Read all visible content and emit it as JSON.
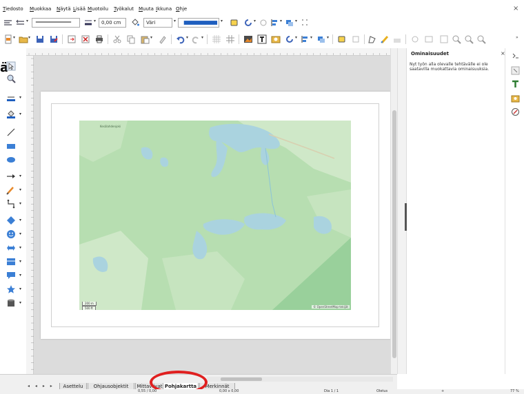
{
  "menubar": {
    "items": [
      "Tiedosto",
      "Muokkaa",
      "Näytä",
      "Lisää",
      "Muotoilu",
      "Työkalut",
      "Muuta",
      "Ikkuna",
      "Ohje"
    ]
  },
  "toolbar1": {
    "line_width_value": "0,00 cm",
    "area_style_value": "Väri"
  },
  "panel": {
    "title": "Ominaisuudet",
    "message": "Nyt työn alla olevalle tehtävälle ei ole saatavilla muokattavia ominaisuuksia."
  },
  "map": {
    "attribution": "© OpenStreetMap-tekijät",
    "scale_top": "200 m",
    "scale_bottom": "500 ft",
    "place_label": "Kesälahdenjoki"
  },
  "tabs": [
    {
      "label": "Asettelu",
      "active": false
    },
    {
      "label": "Ohjausobjektit",
      "active": false
    },
    {
      "label": "Mittaviivat",
      "active": false
    },
    {
      "label": "Pohjakartta",
      "active": true
    },
    {
      "label": "Merkinnät",
      "active": false
    }
  ],
  "statusbar": {
    "position": "0,55 / 0,00",
    "size": "0,00 x 0,00",
    "page": "Dia 1 / 1",
    "layout": "Oletus",
    "zoom": "77 %"
  },
  "colors": {
    "map_forest": "#b7deb1",
    "map_open": "#cfe8c8",
    "map_water": "#aad3df",
    "map_dark": "#99d09b",
    "highlight": "#e02020"
  }
}
